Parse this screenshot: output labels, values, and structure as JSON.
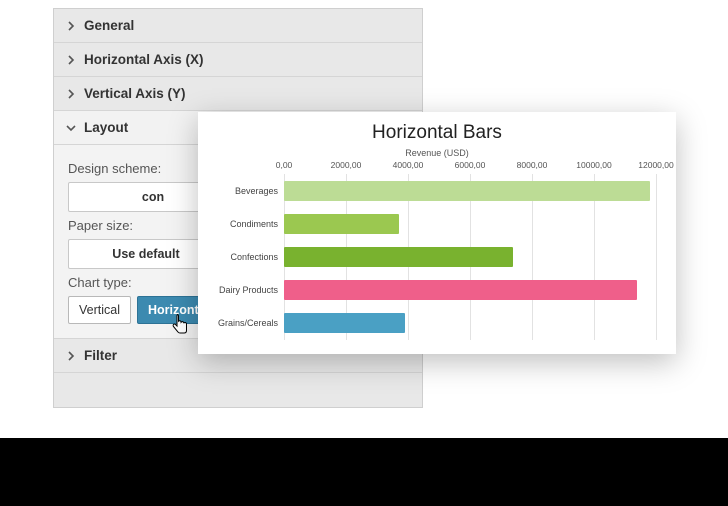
{
  "panel": {
    "sections": {
      "general": "General",
      "haxis": "Horizontal Axis (X)",
      "vaxis": "Vertical Axis (Y)",
      "layout": "Layout",
      "filter": "Filter"
    },
    "layout": {
      "design_scheme_label": "Design scheme:",
      "design_scheme_value": "con",
      "paper_size_label": "Paper size:",
      "paper_size_value": "Use default",
      "chart_type_label": "Chart type:",
      "chart_type_vertical": "Vertical",
      "chart_type_horizontal": "Horizontal"
    }
  },
  "chart": {
    "title": "Horizontal Bars",
    "axis_title": "Revenue (USD)"
  },
  "chart_data": {
    "type": "bar",
    "orientation": "horizontal",
    "title": "Horizontal Bars",
    "xlabel": "Revenue (USD)",
    "ylabel": "",
    "xlim": [
      0,
      12000
    ],
    "tick_labels": [
      "0,00",
      "2000,00",
      "4000,00",
      "6000,00",
      "8000,00",
      "10000,00",
      "12000,00"
    ],
    "categories": [
      "Beverages",
      "Condiments",
      "Confections",
      "Dairy Products",
      "Grains/Cereals"
    ],
    "values": [
      11800,
      3700,
      7400,
      11400,
      3900
    ],
    "colors": [
      "#bcdc95",
      "#9bc850",
      "#79b22f",
      "#ef5f8a",
      "#4aa0c4"
    ]
  }
}
